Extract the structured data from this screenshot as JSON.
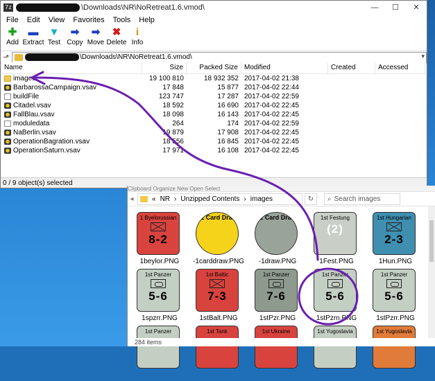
{
  "zip_window": {
    "title": "\\Downloads\\NR\\NoRetreat1.6.vmod\\",
    "app_icon": "7z",
    "window_controls": [
      "—",
      "☐",
      "✕"
    ],
    "menu": [
      "File",
      "Edit",
      "View",
      "Favorites",
      "Tools",
      "Help"
    ],
    "toolbar": [
      {
        "label": "Add",
        "icon": "plus-icon",
        "glyph": "✚",
        "color": "#1aa31a"
      },
      {
        "label": "Extract",
        "icon": "minus-icon",
        "glyph": "▬",
        "color": "#1f3fbf"
      },
      {
        "label": "Test",
        "icon": "check-icon",
        "glyph": "▼",
        "color": "#18b0b8"
      },
      {
        "label": "Copy",
        "icon": "copy-arrow-icon",
        "glyph": "➡",
        "color": "#1f3fbf"
      },
      {
        "label": "Move",
        "icon": "move-arrow-icon",
        "glyph": "➡",
        "color": "#1f3fbf"
      },
      {
        "label": "Delete",
        "icon": "delete-x-icon",
        "glyph": "✖",
        "color": "#d01818"
      },
      {
        "label": "Info",
        "icon": "info-icon",
        "glyph": "i",
        "color": "#c89a00"
      }
    ],
    "address": "\\Downloads\\NR\\NoRetreat1.6.vmod\\",
    "columns": [
      "Name",
      "Size",
      "Packed Size",
      "Modified",
      "Created",
      "Accessed"
    ],
    "files": [
      {
        "name": "images",
        "type": "folder",
        "size": "19 100 810",
        "packed": "18 932 352",
        "modified": "2017-04-02 21:38"
      },
      {
        "name": "BarbarossaCampaign.vsav",
        "type": "vsav",
        "size": "17 848",
        "packed": "15 877",
        "modified": "2017-04-02 22:44"
      },
      {
        "name": "buildFile",
        "type": "doc",
        "size": "123 747",
        "packed": "17 287",
        "modified": "2017-04-02 22:59"
      },
      {
        "name": "Citadel.vsav",
        "type": "vsav",
        "size": "18 592",
        "packed": "16 690",
        "modified": "2017-04-02 22:45"
      },
      {
        "name": "FallBlau.vsav",
        "type": "vsav",
        "size": "18 098",
        "packed": "16 143",
        "modified": "2017-04-02 22:45"
      },
      {
        "name": "moduledata",
        "type": "doc",
        "size": "264",
        "packed": "174",
        "modified": "2017-04-02 22:59"
      },
      {
        "name": "NaBerlin.vsav",
        "type": "vsav",
        "size": "19 879",
        "packed": "17 908",
        "modified": "2017-04-02 22:45"
      },
      {
        "name": "OperationBagration.vsav",
        "type": "vsav",
        "size": "18 556",
        "packed": "16 845",
        "modified": "2017-04-02 22:45"
      },
      {
        "name": "OperationSaturn.vsav",
        "type": "vsav",
        "size": "17 971",
        "packed": "16 108",
        "modified": "2017-04-02 22:45"
      }
    ],
    "status": "0 / 9 object(s) selected"
  },
  "explorer": {
    "ribbon_text": "Clipboard                    Organize                    New                    Open                    Select",
    "breadcrumb": [
      "«",
      "NR",
      "›",
      "Unzipped Contents",
      "›",
      "images"
    ],
    "search_placeholder": "Search images",
    "items": [
      {
        "file": "1beylor.PNG",
        "unit": "1 Byelorussian",
        "value": "8-2",
        "bg": "#d9433e",
        "fg": "#000",
        "sym": "x",
        "card": ""
      },
      {
        "file": "-1carddraw.PNG",
        "unit": "",
        "value": "",
        "bg": "#f5d31a",
        "fg": "#000",
        "sym": "none",
        "card": "–1 Card Draw"
      },
      {
        "file": "-1draw.PNG",
        "unit": "",
        "value": "",
        "bg": "#9aa39a",
        "fg": "#000",
        "sym": "none",
        "card": "–1 Card Draw"
      },
      {
        "file": "1Fest.PNG",
        "unit": "1st Festung",
        "value": "(2)",
        "bg": "#c9cfc6",
        "fg": "#fff",
        "sym": "none",
        "card": ""
      },
      {
        "file": "1Hun.PNG",
        "unit": "1st Hungarian",
        "value": "2-3",
        "bg": "#3f8fb0",
        "fg": "#000",
        "sym": "x",
        "card": ""
      },
      {
        "file": "1spzrr.PNG",
        "unit": "1st Panzer",
        "value": "5-6",
        "bg": "#c4cfc4",
        "fg": "#000",
        "sym": "o",
        "card": ""
      },
      {
        "file": "1stBalt.PNG",
        "unit": "1st Baltic",
        "value": "7-3",
        "bg": "#d9433e",
        "fg": "#000",
        "sym": "x",
        "card": ""
      },
      {
        "file": "1stPzr.PNG",
        "unit": "1st Panzer",
        "value": "7-6",
        "bg": "#8f9a8f",
        "fg": "#000",
        "sym": "o",
        "card": ""
      },
      {
        "file": "1stPzrn.PNG",
        "unit": "1st Panzer",
        "value": "5-6",
        "bg": "#c4cfc4",
        "fg": "#000",
        "sym": "o",
        "card": ""
      },
      {
        "file": "1stPzrr.PNG",
        "unit": "1st Panzer",
        "value": "5-6",
        "bg": "#c4cfc4",
        "fg": "#000",
        "sym": "o",
        "card": ""
      },
      {
        "file": "",
        "unit": "1st Panzer",
        "value": "",
        "bg": "#c4cfc4",
        "fg": "#000",
        "sym": "none",
        "card": ""
      },
      {
        "file": "",
        "unit": "1st Tank",
        "value": "",
        "bg": "#d9433e",
        "fg": "#000",
        "sym": "none",
        "card": ""
      },
      {
        "file": "",
        "unit": "1st Ukraine",
        "value": "",
        "bg": "#d9433e",
        "fg": "#000",
        "sym": "none",
        "card": ""
      },
      {
        "file": "",
        "unit": "1st Yugoslavia",
        "value": "",
        "bg": "#c4cfc4",
        "fg": "#000",
        "sym": "none",
        "card": ""
      },
      {
        "file": "",
        "unit": "1st Yugoslavia",
        "value": "",
        "bg": "#e07b3a",
        "fg": "#000",
        "sym": "none",
        "card": ""
      }
    ],
    "status": "284 items"
  },
  "annotation_color": "#6a1fb0"
}
